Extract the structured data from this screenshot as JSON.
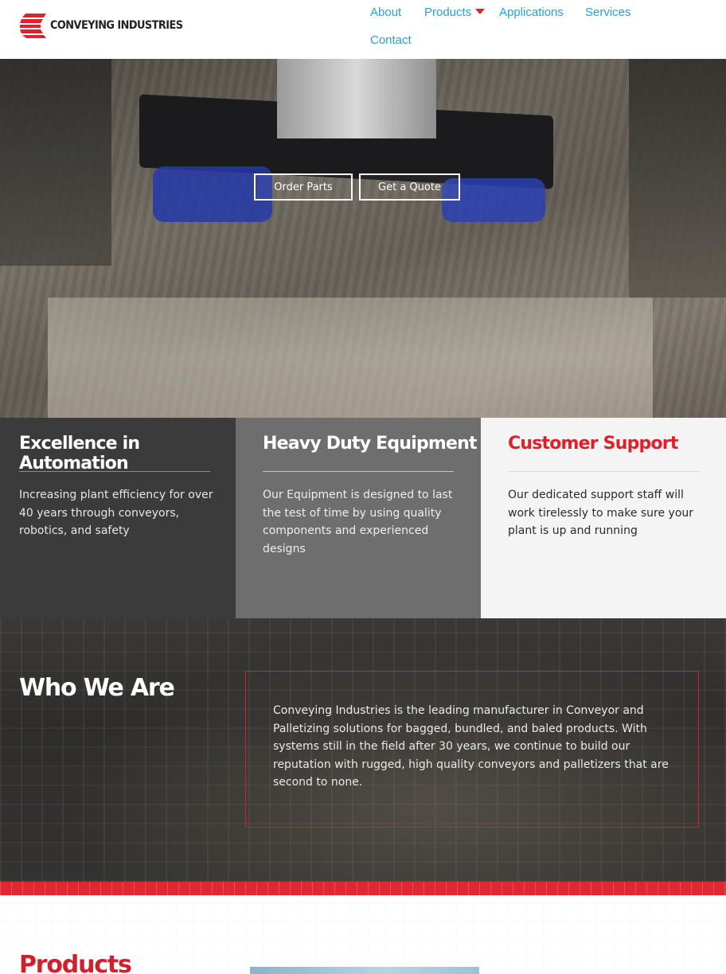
{
  "header": {
    "logo_text": "CONVEYING INDUSTRIES",
    "nav": {
      "about": "About",
      "products": "Products",
      "applications": "Applications",
      "services": "Services",
      "contact": "Contact"
    },
    "nav_color": "#2a9fd6",
    "brand_red": "#e5202e",
    "dropdown_icon": "caret-down-icon"
  },
  "hero": {
    "order_parts": "Order Parts",
    "get_quote": "Get a Quote"
  },
  "features": [
    {
      "title": "Excellence in Automation",
      "text": "Increasing plant efficiency for over 40 years through conveyors, robotics, and safety"
    },
    {
      "title": "Heavy Duty Equipment",
      "text": "Our Equipment is designed to last the test of time by using quality components and experienced designs"
    },
    {
      "title": "Customer Support",
      "text": "Our dedicated support staff will work tirelessly to make sure your plant is up and running"
    }
  ],
  "who": {
    "title": "Who We Are",
    "text": "Conveying Industries is the leading manufacturer in Conveyor and Palletizing solutions for bagged, bundled, and baled products. With systems still in the field after 30 years, we continue to build our reputation with rugged, high quality conveyors and palletizers that are second to none."
  },
  "products": {
    "title": "Products"
  }
}
